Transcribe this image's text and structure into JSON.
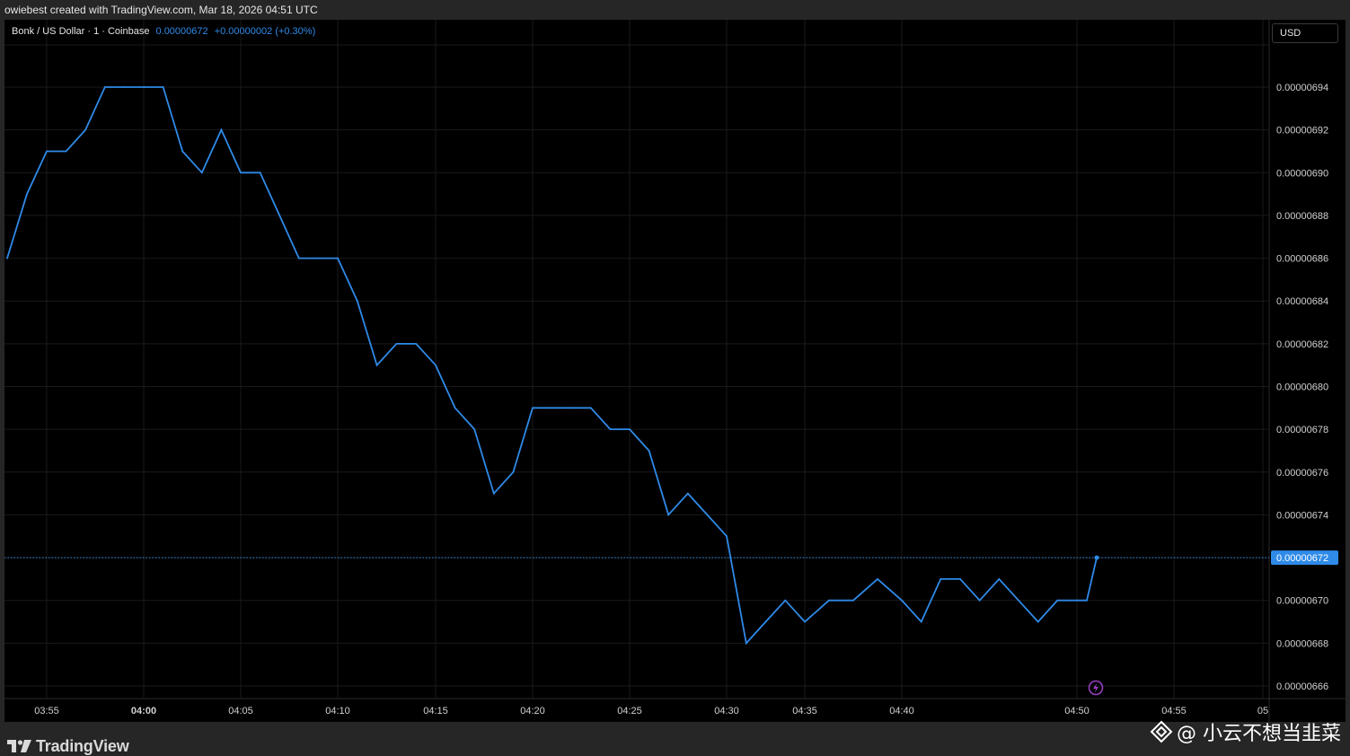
{
  "header": {
    "created_text": "owiebest created with TradingView.com, Mar 18, 2026 04:51 UTC"
  },
  "legend": {
    "symbol": "Bonk / US Dollar · 1 · Coinbase",
    "last": "0.00000672",
    "change": "+0.00000002 (+0.30%)"
  },
  "currency_button": "USD",
  "footer": {
    "logo_text": "TradingView",
    "watermark": "@ 小云不想当韭菜"
  },
  "colors": {
    "line": "#2f8ae8",
    "background": "#000000",
    "grid": "#1a1a1a",
    "axis_text": "#d1d1d1",
    "price_label_bg": "#2f8ae8"
  },
  "chart_data": {
    "type": "line",
    "title": "Bonk / US Dollar · 1 · Coinbase",
    "xlabel": "",
    "ylabel": "",
    "x_ticks": [
      {
        "label": "03:55",
        "minute": 235,
        "bold": false
      },
      {
        "label": "04:00",
        "minute": 240,
        "bold": true
      },
      {
        "label": "04:05",
        "minute": 245,
        "bold": false
      },
      {
        "label": "04:10",
        "minute": 250,
        "bold": false
      },
      {
        "label": "04:15",
        "minute": 255,
        "bold": false
      },
      {
        "label": "04:20",
        "minute": 260,
        "bold": false
      },
      {
        "label": "04:25",
        "minute": 265,
        "bold": false
      },
      {
        "label": "04:30",
        "minute": 270,
        "bold": false
      },
      {
        "label": "04:35",
        "minute": 274,
        "bold": false
      },
      {
        "label": "04:40",
        "minute": 278,
        "bold": false
      },
      {
        "label": "04:50",
        "minute": 287,
        "bold": false
      },
      {
        "label": "04:55",
        "minute": 292,
        "bold": false
      },
      {
        "label": "05",
        "minute": 297,
        "bold": false
      }
    ],
    "y_ticks": [
      "0.00000666",
      "0.00000668",
      "0.00000670",
      "0.00000674",
      "0.00000676",
      "0.00000678",
      "0.00000680",
      "0.00000682",
      "0.00000684",
      "0.00000686",
      "0.00000688",
      "0.00000690",
      "0.00000692",
      "0.00000694"
    ],
    "ylim": [
      6.66e-06,
      6.94e-06
    ],
    "last_price_label": "0.00000672",
    "series": [
      {
        "values": [
          [
            233,
            6.86e-06
          ],
          [
            234,
            6.89e-06
          ],
          [
            235,
            6.91e-06
          ],
          [
            236,
            6.91e-06
          ],
          [
            237,
            6.92e-06
          ],
          [
            238,
            6.94e-06
          ],
          [
            239,
            6.94e-06
          ],
          [
            240,
            6.94e-06
          ],
          [
            241,
            6.94e-06
          ],
          [
            242,
            6.91e-06
          ],
          [
            243,
            6.9e-06
          ],
          [
            244,
            6.92e-06
          ],
          [
            245,
            6.9e-06
          ],
          [
            246,
            6.9e-06
          ],
          [
            247,
            6.88e-06
          ],
          [
            248,
            6.86e-06
          ],
          [
            249,
            6.86e-06
          ],
          [
            250,
            6.86e-06
          ],
          [
            251,
            6.84e-06
          ],
          [
            252,
            6.81e-06
          ],
          [
            253,
            6.82e-06
          ],
          [
            254,
            6.82e-06
          ],
          [
            255,
            6.81e-06
          ],
          [
            256,
            6.79e-06
          ],
          [
            257,
            6.78e-06
          ],
          [
            258,
            6.75e-06
          ],
          [
            259,
            6.76e-06
          ],
          [
            260,
            6.79e-06
          ],
          [
            261,
            6.79e-06
          ],
          [
            262,
            6.79e-06
          ],
          [
            263,
            6.79e-06
          ],
          [
            264,
            6.78e-06
          ],
          [
            265,
            6.78e-06
          ],
          [
            266,
            6.77e-06
          ],
          [
            267,
            6.74e-06
          ],
          [
            268,
            6.75e-06
          ],
          [
            269,
            6.74e-06
          ],
          [
            270,
            6.73e-06
          ],
          [
            271,
            6.68e-06
          ],
          [
            272,
            6.69e-06
          ],
          [
            273,
            6.7e-06
          ],
          [
            274,
            6.69e-06
          ],
          [
            275,
            6.7e-06
          ],
          [
            276,
            6.7e-06
          ],
          [
            277,
            6.71e-06
          ],
          [
            278,
            6.7e-06
          ],
          [
            279,
            6.69e-06
          ],
          [
            280,
            6.71e-06
          ],
          [
            281,
            6.71e-06
          ],
          [
            282,
            6.7e-06
          ],
          [
            283,
            6.71e-06
          ],
          [
            284,
            6.7e-06
          ],
          [
            285,
            6.69e-06
          ],
          [
            286,
            6.7e-06
          ],
          [
            287,
            6.7e-06
          ],
          [
            288,
            6.7e-06
          ],
          [
            289,
            6.72e-06
          ]
        ]
      }
    ]
  }
}
